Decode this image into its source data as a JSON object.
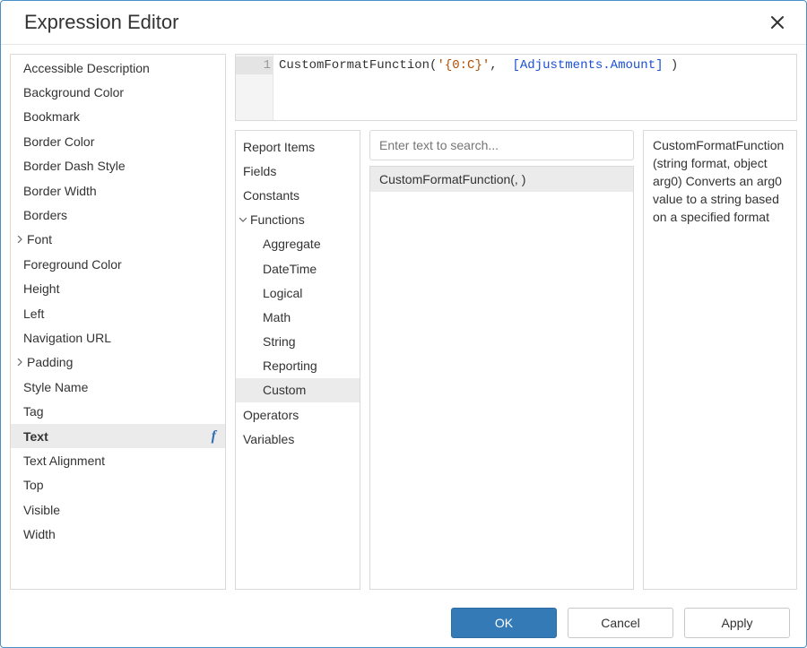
{
  "dialog": {
    "title": "Expression Editor"
  },
  "sidebar": {
    "items": [
      {
        "label": "Accessible Description",
        "expandable": false
      },
      {
        "label": "Background Color",
        "expandable": false
      },
      {
        "label": "Bookmark",
        "expandable": false
      },
      {
        "label": "Border Color",
        "expandable": false
      },
      {
        "label": "Border Dash Style",
        "expandable": false
      },
      {
        "label": "Border Width",
        "expandable": false
      },
      {
        "label": "Borders",
        "expandable": false
      },
      {
        "label": "Font",
        "expandable": true
      },
      {
        "label": "Foreground Color",
        "expandable": false
      },
      {
        "label": "Height",
        "expandable": false
      },
      {
        "label": "Left",
        "expandable": false
      },
      {
        "label": "Navigation URL",
        "expandable": false
      },
      {
        "label": "Padding",
        "expandable": true
      },
      {
        "label": "Style Name",
        "expandable": false
      },
      {
        "label": "Tag",
        "expandable": false
      },
      {
        "label": "Text",
        "expandable": false,
        "selected": true,
        "fx": true
      },
      {
        "label": "Text Alignment",
        "expandable": false
      },
      {
        "label": "Top",
        "expandable": false
      },
      {
        "label": "Visible",
        "expandable": false
      },
      {
        "label": "Width",
        "expandable": false
      }
    ]
  },
  "editor": {
    "line_number": "1",
    "tokens": {
      "fn": "CustomFormatFunction(",
      "str": "'{0:C}'",
      "sep": ",  ",
      "field": "[Adjustments.Amount]",
      "close": " )"
    }
  },
  "categories": {
    "items": [
      {
        "label": "Report Items",
        "level": 0
      },
      {
        "label": "Fields",
        "level": 0
      },
      {
        "label": "Constants",
        "level": 0
      },
      {
        "label": "Functions",
        "level": 0,
        "expanded": true
      },
      {
        "label": "Aggregate",
        "level": 1
      },
      {
        "label": "DateTime",
        "level": 1
      },
      {
        "label": "Logical",
        "level": 1
      },
      {
        "label": "Math",
        "level": 1
      },
      {
        "label": "String",
        "level": 1
      },
      {
        "label": "Reporting",
        "level": 1
      },
      {
        "label": "Custom",
        "level": 1,
        "selected": true
      },
      {
        "label": "Operators",
        "level": 0
      },
      {
        "label": "Variables",
        "level": 0
      }
    ]
  },
  "search": {
    "placeholder": "Enter text to search..."
  },
  "function_list": {
    "items": [
      {
        "label": "CustomFormatFunction(, )",
        "selected": true
      }
    ]
  },
  "description": {
    "text": "CustomFormatFunction(string format, object arg0) Converts an arg0 value to a string based on a specified format"
  },
  "footer": {
    "ok": "OK",
    "cancel": "Cancel",
    "apply": "Apply"
  }
}
